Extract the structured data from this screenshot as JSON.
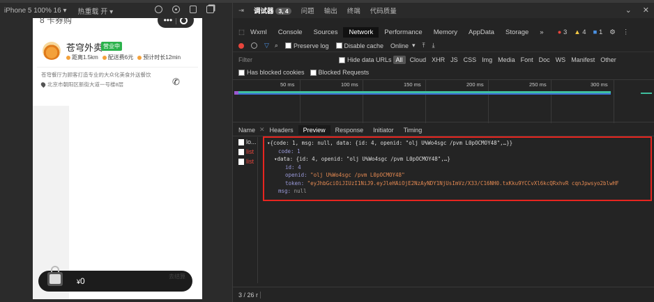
{
  "simulator": {
    "device_label": "iPhone 5 100% 16 ▾",
    "hot_reload_label": "热重载 开 ▾"
  },
  "phone": {
    "top_text": "8 卡券购",
    "shop": {
      "name": "苍穹外卖",
      "status_badge": "营业中",
      "metrics": [
        "距离1.5km",
        "配送费6元",
        "预计时长12min"
      ],
      "description": "苍穹餐厅为顾客打造专业的大众化美食外送餐饮",
      "address": "北京市朝阳区新街大道一号楼8层"
    },
    "cart": {
      "currency": "¥",
      "total": "0",
      "right_text": "去结算"
    }
  },
  "devtools": {
    "top_tabs": [
      {
        "label": "调试器",
        "badge": "3, 4",
        "active": true
      },
      {
        "label": "问题"
      },
      {
        "label": "输出"
      },
      {
        "label": "终端"
      },
      {
        "label": "代码质量"
      }
    ],
    "panel_tabs": [
      "Wxml",
      "Console",
      "Sources",
      "Network",
      "Performance",
      "Memory",
      "AppData",
      "Storage",
      "»"
    ],
    "active_panel": "Network",
    "counts": {
      "errors": "3",
      "warnings": "4",
      "info": "1"
    },
    "network_toolbar": {
      "preserve_log": "Preserve log",
      "disable_cache": "Disable cache",
      "online": "Online"
    },
    "filter": {
      "placeholder": "Filter",
      "hide_data_urls": "Hide data URLs",
      "all": "All",
      "types": [
        "Cloud",
        "XHR",
        "JS",
        "CSS",
        "Img",
        "Media",
        "Font",
        "Doc",
        "WS",
        "Manifest",
        "Other"
      ]
    },
    "blocked": {
      "has_blocked_cookies": "Has blocked cookies",
      "blocked_requests": "Blocked Requests"
    },
    "timeline_ticks": [
      "50 ms",
      "100 ms",
      "150 ms",
      "200 ms",
      "250 ms",
      "300 ms"
    ],
    "detail_tabs": {
      "name": "Name",
      "tabs": [
        "Headers",
        "Preview",
        "Response",
        "Initiator",
        "Timing"
      ],
      "active": "Preview"
    },
    "requests": [
      {
        "name": "lo...",
        "color": "#dddddd"
      },
      {
        "name": "list",
        "color": "#e8453c"
      },
      {
        "name": "list",
        "color": "#e8453c"
      }
    ],
    "preview": {
      "summary": "▾{code: 1, msg: null, data: {id: 4, openid: \"olj U%Wo4sgc /pvm L0pOCMOY48\",…}}",
      "code_key": "code:",
      "code_val": "1",
      "data_summary": "▾data: {id: 4, openid: \"olj U%Wo4sgc /pvm L0pOCMOY48\",…}",
      "id_key": "id:",
      "id_val": "4",
      "openid_key": "openid:",
      "openid_val": "\"olj U%Wo4sgc /pvm L0pOCMOY48\"",
      "token_key": "token:",
      "token_val": "\"eyJhbGciOiJIUzI1NiJ9.eyJleHAiOjE2NzAyNDY1NjUsImVz/X33/C16NH0.txKku9YCCvXl6kcQRxhvR cqnJpwsyo2blwHF",
      "msg_key": "msg:",
      "msg_val": "null"
    },
    "status_text": "3 / 26 r"
  }
}
